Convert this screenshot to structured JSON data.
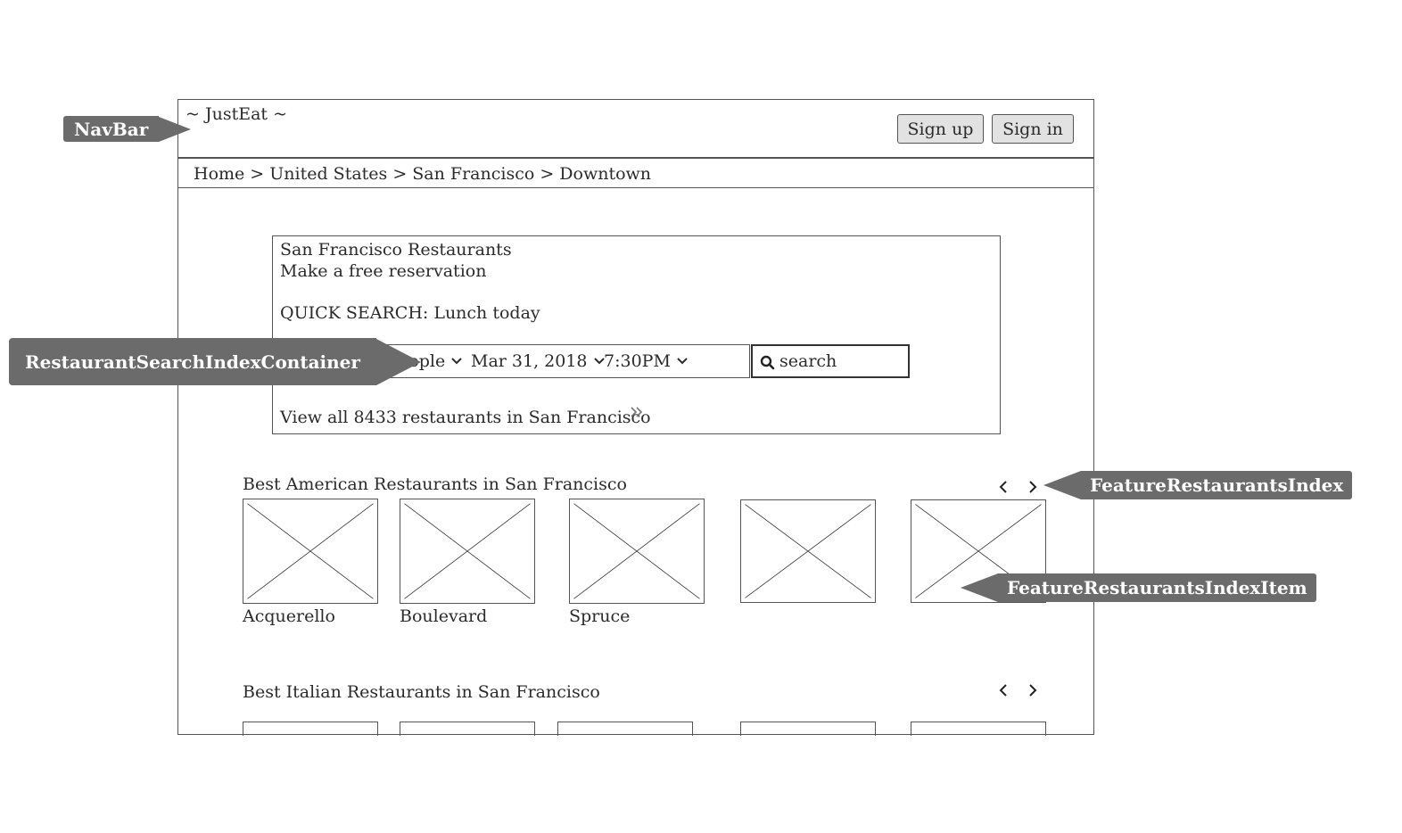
{
  "navbar": {
    "logo": "~ JustEat ~",
    "signup_label": "Sign up",
    "signin_label": "Sign in"
  },
  "breadcrumb": "Home > United States > San Francisco > Downtown",
  "search_panel": {
    "title": "San Francisco Restaurants",
    "subtitle": "Make a free reservation",
    "quick_search": "QUICK SEARCH: Lunch today",
    "people": "3 People",
    "date": "Mar 31, 2018",
    "time": "7:30PM",
    "search_placeholder": "search",
    "view_all": "View all 8433 restaurants in San Francisco"
  },
  "sections": [
    {
      "title": "Best American Restaurants in San Francisco",
      "items": [
        "Acquerello",
        "Boulevard",
        "Spruce",
        "",
        ""
      ]
    },
    {
      "title": "Best Italian Restaurants in San Francisco",
      "items": []
    }
  ],
  "annotations": {
    "navbar": "NavBar",
    "search_container": "RestaurantSearchIndexContainer",
    "feature_index": "FeatureRestaurantsIndex",
    "feature_item": "FeatureRestaurantsIndexItem"
  },
  "colors": {
    "callout": "#6b6b6b",
    "border": "#555555",
    "button_bg": "#e2e2e2"
  }
}
